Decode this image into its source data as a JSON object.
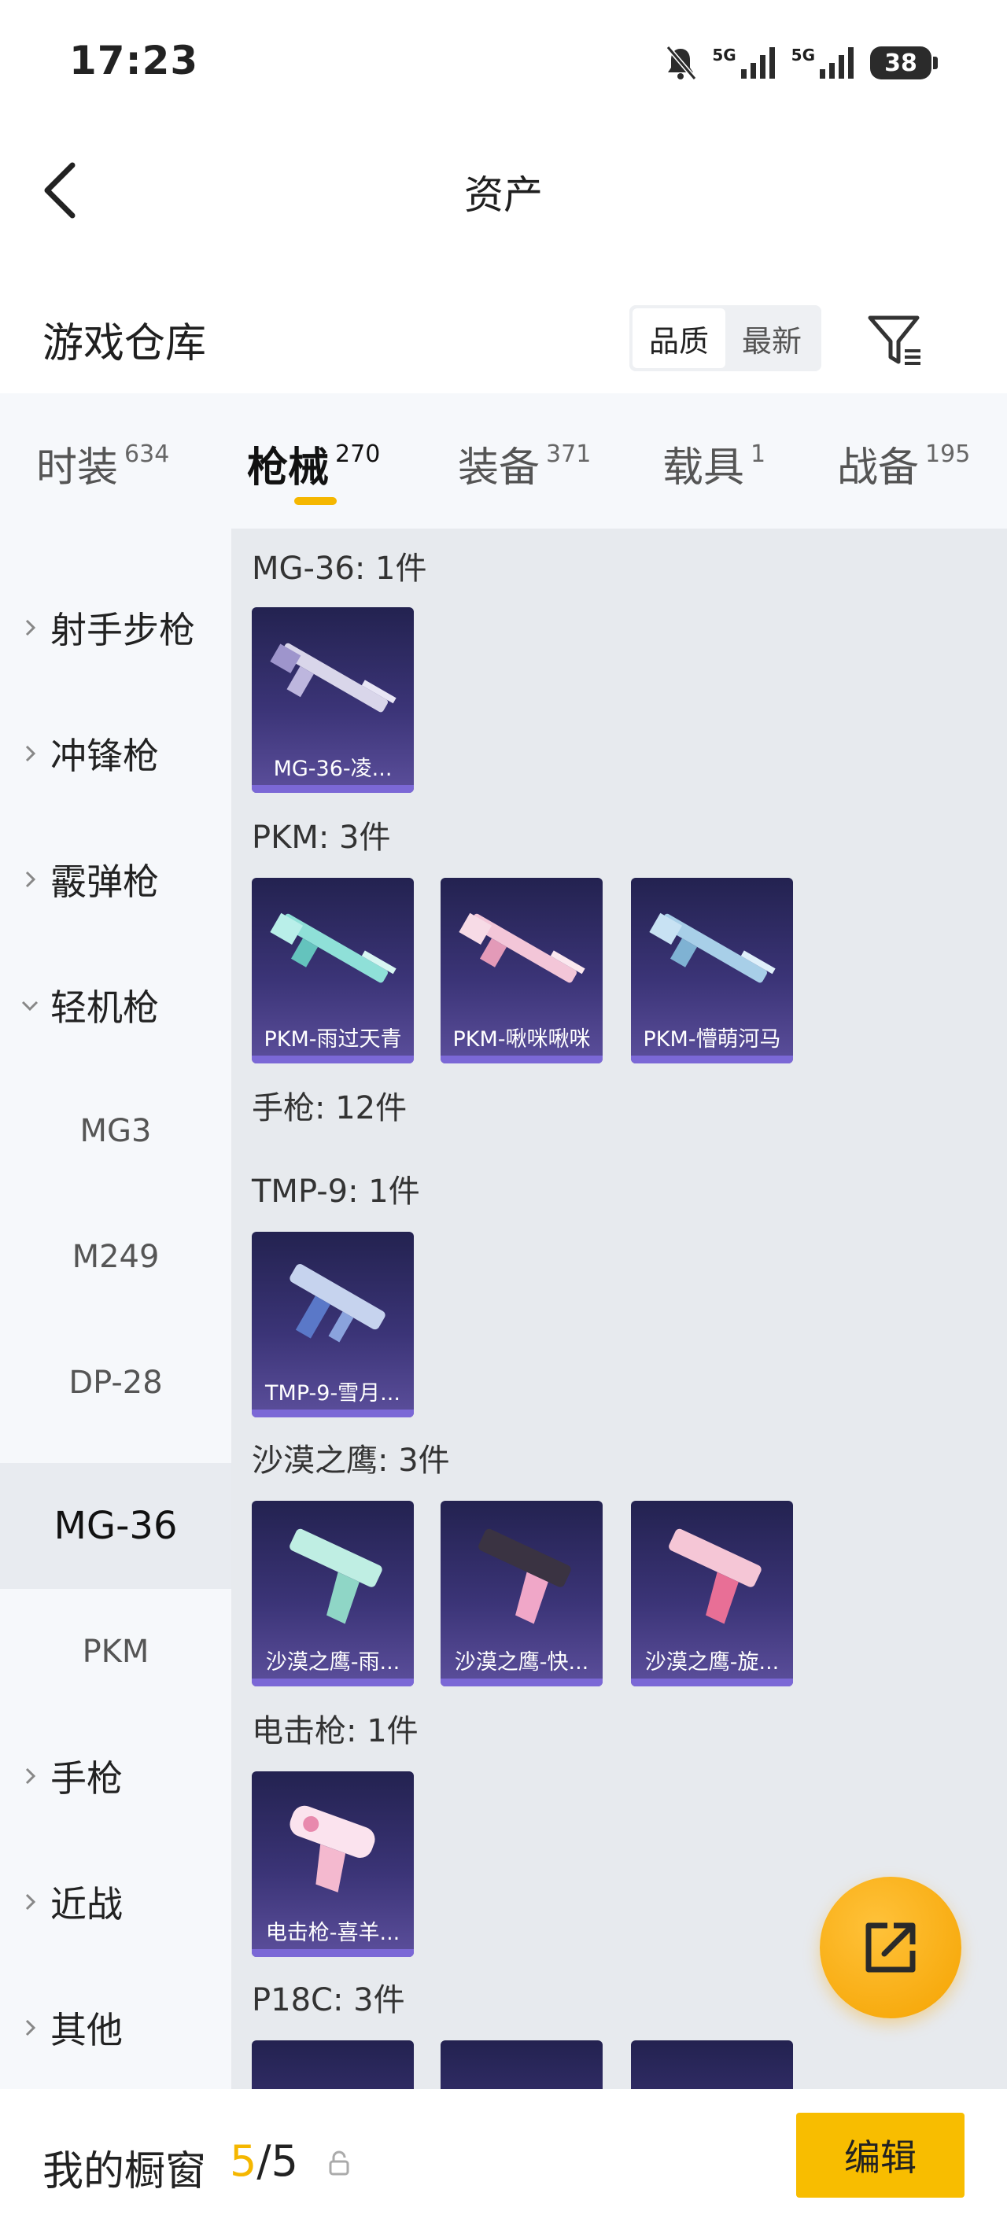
{
  "status_bar": {
    "time": "17:23",
    "network1": "5G",
    "network2": "5G",
    "battery": "38"
  },
  "header": {
    "title": "资产"
  },
  "warehouse": {
    "title": "游戏仓库",
    "sort_options": [
      "品质",
      "最新"
    ],
    "active_sort": "品质"
  },
  "tabs": [
    {
      "label": "时装",
      "count": "634"
    },
    {
      "label": "枪械",
      "count": "270",
      "active": true
    },
    {
      "label": "装备",
      "count": "371"
    },
    {
      "label": "载具",
      "count": "1"
    },
    {
      "label": "战备",
      "count": "195"
    }
  ],
  "sidebar": {
    "categories": [
      {
        "label": "射手步枪",
        "expanded": false
      },
      {
        "label": "冲锋枪",
        "expanded": false
      },
      {
        "label": "霰弹枪",
        "expanded": false
      },
      {
        "label": "轻机枪",
        "expanded": true
      },
      {
        "label": "手枪",
        "expanded": false
      },
      {
        "label": "近战",
        "expanded": false
      },
      {
        "label": "其他",
        "expanded": false
      }
    ],
    "subitems": [
      "MG3",
      "M249",
      "DP-28",
      "MG-36",
      "PKM"
    ],
    "selected_subitem": "MG-36"
  },
  "groups": [
    {
      "title": "MG-36: 1件",
      "items": [
        "MG-36-凌..."
      ]
    },
    {
      "title": "PKM: 3件",
      "items": [
        "PKM-雨过天青",
        "PKM-啾咪啾咪",
        "PKM-懵萌河马"
      ]
    },
    {
      "title": "手枪: 12件"
    },
    {
      "title": "TMP-9: 1件",
      "items": [
        "TMP-9-雪月..."
      ]
    },
    {
      "title": "沙漠之鹰: 3件",
      "items": [
        "沙漠之鹰-雨...",
        "沙漠之鹰-快...",
        "沙漠之鹰-旋..."
      ]
    },
    {
      "title": "电击枪: 1件",
      "items": [
        "电击枪-喜羊..."
      ]
    },
    {
      "title": "P18C: 3件"
    }
  ],
  "bottom_bar": {
    "title": "我的橱窗",
    "current": "5",
    "separator": "/",
    "total": "5",
    "edit_label": "编辑"
  },
  "colors": {
    "accent": "#f5b700",
    "card_top": "#232250",
    "card_bottom": "#5c4f9c"
  },
  "icons": [
    "mute-bell-icon",
    "signal-icon",
    "battery-icon",
    "back-arrow-icon",
    "filter-icon",
    "chevron-right-icon",
    "chevron-down-icon",
    "share-external-icon",
    "lock-icon"
  ]
}
